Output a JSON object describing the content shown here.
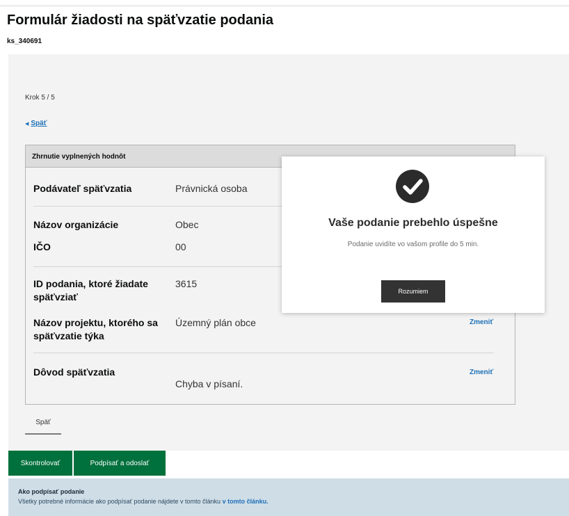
{
  "header": {
    "title": "Formulár žiadosti na späťvzatie podania",
    "form_id": "ks_340691"
  },
  "step": {
    "label": "Krok 5 / 5"
  },
  "back_link": {
    "label": "Späť"
  },
  "summary": {
    "heading": "Zhrnutie vyplnených hodnôt",
    "rows": [
      {
        "key": "Podávateľ späťvzatia",
        "value": "Právnická osoba",
        "action": ""
      },
      {
        "key": "Názov organizácie",
        "value": "Obec",
        "action": ""
      },
      {
        "key": "IČO",
        "value": "00",
        "action": ""
      },
      {
        "key": "ID podania, ktoré žiadate späťvziať",
        "value": "3615",
        "action": ""
      },
      {
        "key": "Názov projektu, ktorého sa späťvzatie týka",
        "value": "Územný plán obce",
        "action": "Zmeniť"
      },
      {
        "key": "Dôvod späťvzatia",
        "value": "Chyba v písaní.",
        "action": "Zmeniť"
      }
    ]
  },
  "buttons": {
    "back": "Späť",
    "check": "Skontrolovať",
    "sign_send": "Podpísať a odoslať"
  },
  "info": {
    "title": "Ako podpísať podanie",
    "text": "Všetky potrebné informácie ako podpísať podanie nájdete v tomto článku",
    "link": "v tomto článku."
  },
  "modal": {
    "icon": "check-circle-icon",
    "title": "Vaše podanie prebehlo úspešne",
    "text": "Podanie uvidíte vo vašom profile do 5 min.",
    "button": "Rozumiem"
  },
  "colors": {
    "primary_green": "#00703c",
    "link_blue": "#1d70b8",
    "modal_button": "#333333",
    "info_background": "#cfdde6"
  }
}
